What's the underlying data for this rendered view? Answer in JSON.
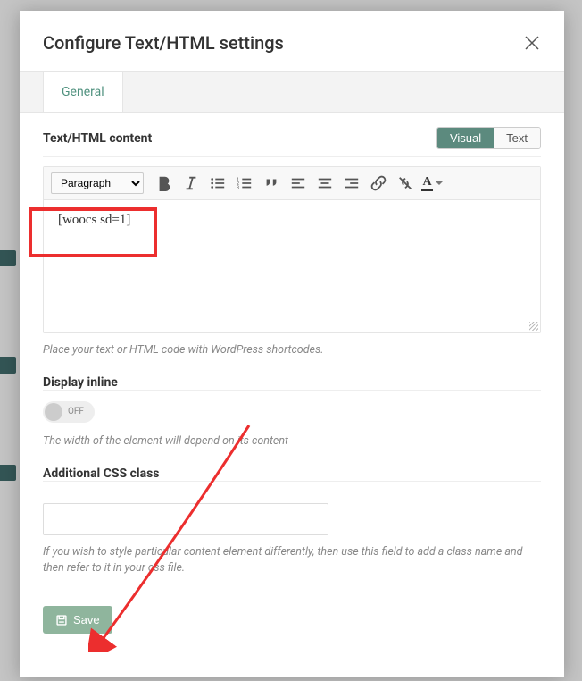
{
  "modal": {
    "title": "Configure Text/HTML settings",
    "tabs": [
      {
        "label": "General",
        "active": true
      }
    ]
  },
  "content_field": {
    "label": "Text/HTML content",
    "mode_tabs": {
      "visual": "Visual",
      "text": "Text",
      "active": "visual"
    },
    "format_select": "Paragraph",
    "body_text": "[woocs sd=1]",
    "help": "Place your text or HTML code with WordPress shortcodes."
  },
  "inline_field": {
    "label": "Display inline",
    "switch_state": "OFF",
    "help": "The width of the element will depend on its content"
  },
  "css_field": {
    "label": "Additional CSS class",
    "value": "",
    "help": "If you wish to style particular content element differently, then use this field to add a class name and then refer to it in your css file."
  },
  "buttons": {
    "save": "Save"
  },
  "colors": {
    "accent": "#5c8a7e",
    "highlight": "#ec2e2e"
  }
}
